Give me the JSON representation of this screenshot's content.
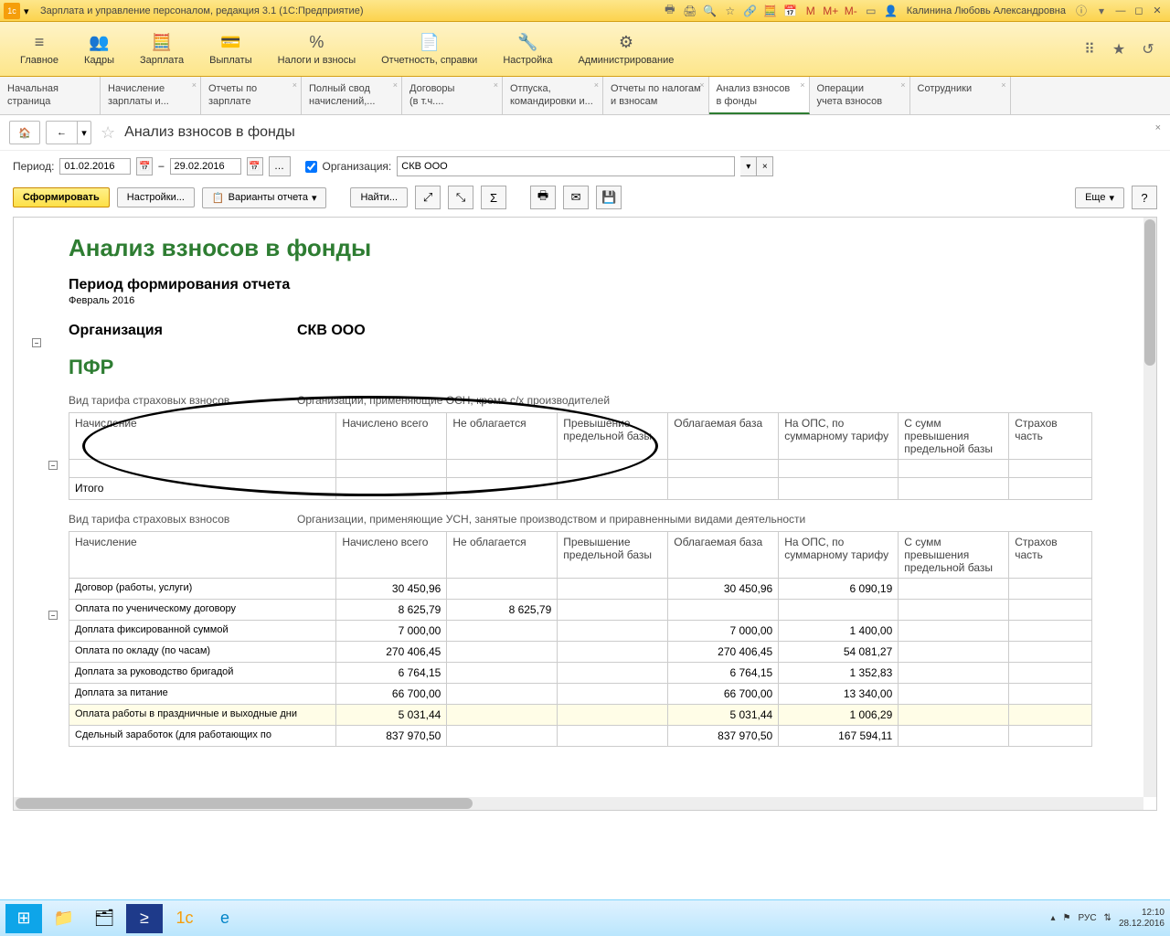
{
  "titlebar": {
    "app_title": "Зарплата и управление персоналом, редакция 3.1  (1С:Предприятие)",
    "user": "Калинина Любовь Александровна",
    "m": "M",
    "mplus": "M+",
    "mminus": "M-"
  },
  "mainmenu": [
    {
      "icon": "≡",
      "label": "Главное"
    },
    {
      "icon": "👥",
      "label": "Кадры"
    },
    {
      "icon": "🧮",
      "label": "Зарплата"
    },
    {
      "icon": "💳",
      "label": "Выплаты"
    },
    {
      "icon": "%",
      "label": "Налоги и взносы"
    },
    {
      "icon": "📄",
      "label": "Отчетность, справки"
    },
    {
      "icon": "🔧",
      "label": "Настройка"
    },
    {
      "icon": "⚙",
      "label": "Администрирование"
    }
  ],
  "tabs": [
    {
      "l1": "Начальная",
      "l2": "страница",
      "close": false
    },
    {
      "l1": "Начисление",
      "l2": "зарплаты и...",
      "close": true
    },
    {
      "l1": "Отчеты по",
      "l2": "зарплате",
      "close": true
    },
    {
      "l1": "Полный свод",
      "l2": "начислений,...",
      "close": true
    },
    {
      "l1": "Договоры",
      "l2": "(в т.ч....",
      "close": true
    },
    {
      "l1": "Отпуска,",
      "l2": "командировки и...",
      "close": true
    },
    {
      "l1": "Отчеты по налогам",
      "l2": "и взносам",
      "close": true
    },
    {
      "l1": "Анализ взносов",
      "l2": "в фонды",
      "close": true,
      "active": true
    },
    {
      "l1": "Операции",
      "l2": "учета взносов",
      "close": true
    },
    {
      "l1": "Сотрудники",
      "l2": "",
      "close": true
    }
  ],
  "page": {
    "title": "Анализ взносов в фонды"
  },
  "period": {
    "label": "Период:",
    "from": "01.02.2016",
    "to": "29.02.2016",
    "dash": "–",
    "org_label": "Организация:",
    "org_value": "СКВ ООО"
  },
  "toolbar": {
    "generate": "Сформировать",
    "settings": "Настройки...",
    "variants": "Варианты отчета",
    "find": "Найти...",
    "more": "Еще"
  },
  "report": {
    "title": "Анализ взносов в фонды",
    "period_header": "Период формирования отчета",
    "period_value": "Февраль 2016",
    "org_label": "Организация",
    "org_value": "СКВ ООО",
    "pfr": "ПФР",
    "tariff_label": "Вид тарифа страховых взносов",
    "tariff1": "Организации, применяющие ОСН, кроме с/х производителей",
    "tariff2": "Организации, применяющие УСН, занятые производством и приравненными видами деятельности",
    "cols": {
      "c1": "Начисление",
      "c2": "Начислено всего",
      "c3": "Не облагается",
      "c4": "Превышение предельной базы",
      "c5": "Облагаемая база",
      "c6": "На ОПС, по суммарному тарифу",
      "c7": "С сумм превышения предельной базы",
      "c8": "Страхов часть"
    },
    "itogo": "Итого",
    "rows": [
      {
        "name": "Договор (работы, услуги)",
        "c2": "30 450,96",
        "c3": "",
        "c5": "30 450,96",
        "c6": "6 090,19"
      },
      {
        "name": "Оплата по ученическому договору",
        "c2": "8 625,79",
        "c3": "8 625,79",
        "c5": "",
        "c6": ""
      },
      {
        "name": "Доплата фиксированной суммой",
        "c2": "7 000,00",
        "c3": "",
        "c5": "7 000,00",
        "c6": "1 400,00"
      },
      {
        "name": "Оплата по окладу (по часам)",
        "c2": "270 406,45",
        "c3": "",
        "c5": "270 406,45",
        "c6": "54 081,27"
      },
      {
        "name": "Доплата за руководство бригадой",
        "c2": "6 764,15",
        "c3": "",
        "c5": "6 764,15",
        "c6": "1 352,83"
      },
      {
        "name": "Доплата за питание",
        "c2": "66 700,00",
        "c3": "",
        "c5": "66 700,00",
        "c6": "13 340,00"
      },
      {
        "name": "Оплата работы в праздничные и выходные дни",
        "c2": "5 031,44",
        "c3": "",
        "c5": "5 031,44",
        "c6": "1 006,29",
        "hl": true
      },
      {
        "name": "Сдельный заработок (для работающих по",
        "c2": "837 970,50",
        "c3": "",
        "c5": "837 970,50",
        "c6": "167 594,11"
      }
    ]
  },
  "taskbar": {
    "time": "12:10",
    "date": "28.12.2016",
    "lang": "РУС"
  }
}
